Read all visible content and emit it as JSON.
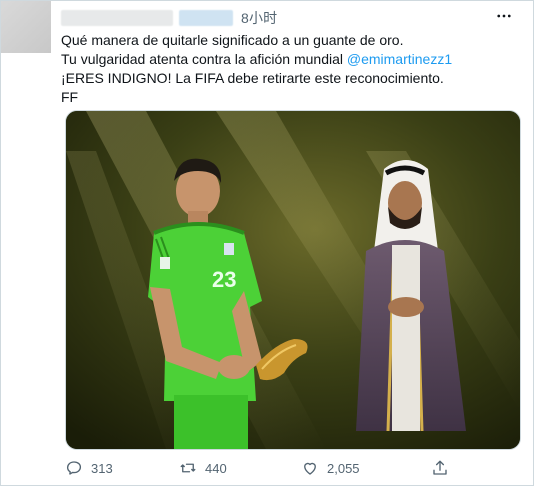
{
  "tweet": {
    "time": "8小时",
    "lines": [
      "Qué manera de quitarle significado a un guante de oro.",
      "Tu vulgaridad atenta contra la afición mundial ",
      "¡ERES INDIGNO! La FIFA debe retirarte este reconocimiento.",
      "FF"
    ],
    "mention": "@emimartinezz1"
  },
  "media": {
    "jersey_number": "23"
  },
  "actions": {
    "reply_count": "313",
    "retweet_count": "440",
    "like_count": "2,055"
  },
  "icons": {
    "reply": "reply-icon",
    "retweet": "retweet-icon",
    "like": "heart-icon",
    "share": "share-icon",
    "more": "more-icon"
  },
  "colors": {
    "accent": "#1d9bf0",
    "muted_text": "#536471",
    "jersey": "#4cd137"
  }
}
